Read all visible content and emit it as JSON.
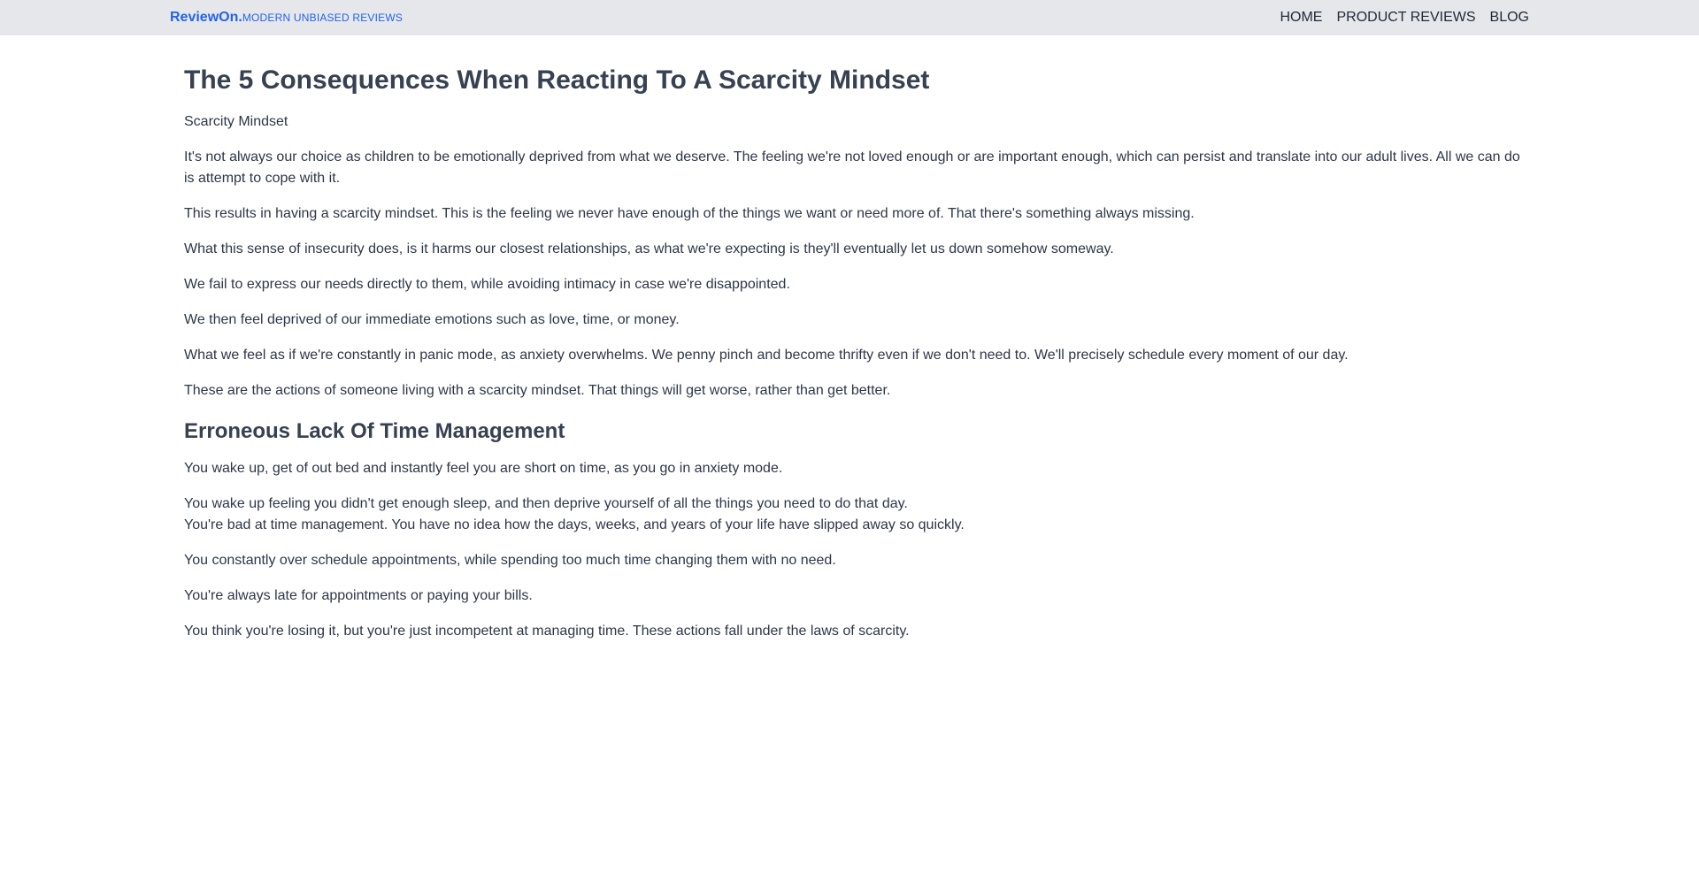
{
  "header": {
    "brand_name": "ReviewOn.",
    "brand_tagline": "MODERN UNBIASED REVIEWS",
    "nav": [
      {
        "label": "HOME"
      },
      {
        "label": "PRODUCT REVIEWS"
      },
      {
        "label": "BLOG"
      }
    ]
  },
  "article": {
    "title": "The 5 Consequences When Reacting To A Scarcity Mindset",
    "subtitle": "Scarcity Mindset",
    "paragraphs": [
      "It's not always our choice as children to be emotionally deprived from what we deserve. The feeling we're not loved enough or are important enough, which can persist and translate into our adult lives. All we can do is attempt to cope with it.",
      "This results in having a scarcity mindset. This is the feeling we never have enough of the things we want or need more of. That there's something always missing.",
      "What this sense of insecurity does, is it harms our closest relationships, as what we're expecting is they'll eventually let us down somehow someway.",
      "We fail to express our needs directly to them, while avoiding intimacy in case we're disappointed.",
      "We then feel deprived of our immediate emotions such as love, time, or money.",
      "What we feel as if we're constantly in panic mode, as anxiety overwhelms. We penny pinch and become thrifty even if we don't need to. We'll precisely schedule every moment of our day.",
      "These are the actions of someone living with a scarcity mindset. That things will get worse, rather than get better."
    ],
    "section": {
      "heading": "Erroneous Lack Of Time Management",
      "paragraphs": [
        "You wake up, get of out bed and instantly feel you are short on time, as you go in anxiety mode.",
        "You wake up feeling you didn't get enough sleep, and then deprive yourself of all the things you need to do that day.",
        "You're bad at time management. You have no idea how the days, weeks, and years of your life have slipped away so quickly.",
        "You constantly over schedule appointments, while spending too much time changing them with no need.",
        "You're always late for appointments or paying your bills.",
        "You think you're losing it, but you're just incompetent at managing time. These actions fall under the laws of scarcity."
      ]
    }
  }
}
